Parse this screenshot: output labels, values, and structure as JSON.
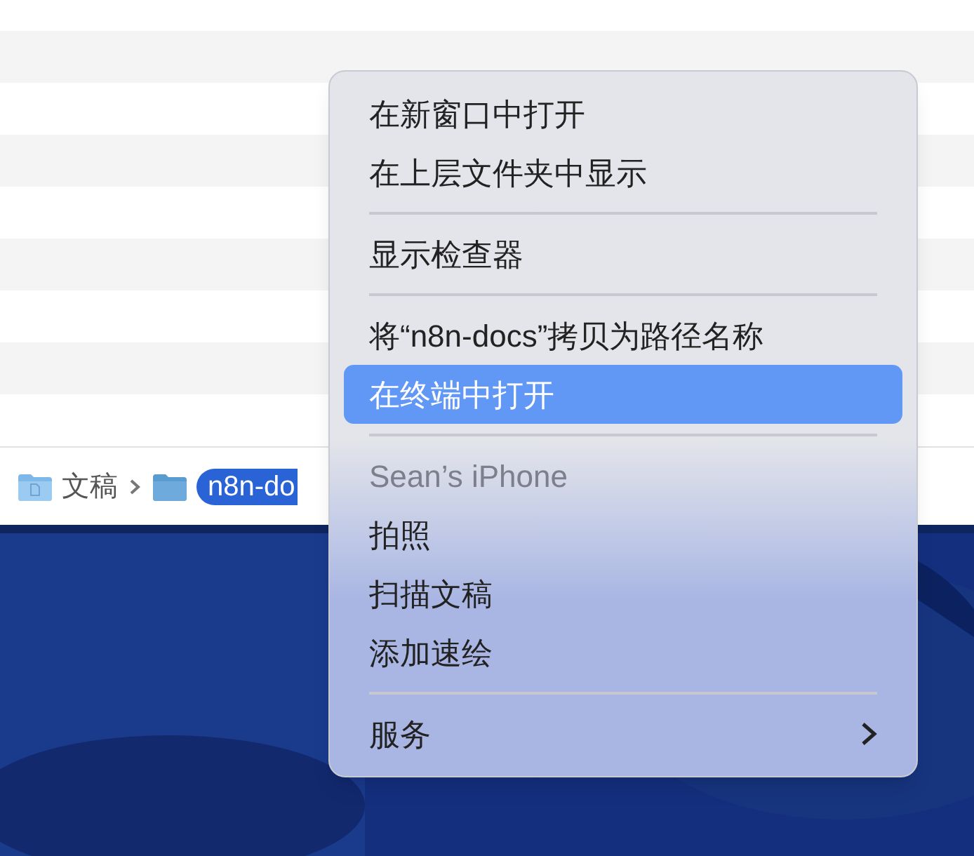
{
  "path_bar": [
    {
      "label": "文稿",
      "kind": "document-folder",
      "selected": false
    },
    {
      "label": "n8n-do",
      "kind": "folder",
      "selected": true
    }
  ],
  "context_menu": [
    {
      "kind": "item",
      "label": "在新窗口中打开",
      "selected": false
    },
    {
      "kind": "item",
      "label": "在上层文件夹中显示",
      "selected": false
    },
    {
      "kind": "separator"
    },
    {
      "kind": "item",
      "label": "显示检查器",
      "selected": false
    },
    {
      "kind": "separator"
    },
    {
      "kind": "item",
      "label": "将“n8n-docs”拷贝为路径名称",
      "selected": false
    },
    {
      "kind": "item",
      "label": "在终端中打开",
      "selected": true
    },
    {
      "kind": "separator"
    },
    {
      "kind": "header",
      "label": "Sean’s iPhone"
    },
    {
      "kind": "item",
      "label": "拍照",
      "selected": false
    },
    {
      "kind": "item",
      "label": "扫描文稿",
      "selected": false
    },
    {
      "kind": "item",
      "label": "添加速绘",
      "selected": false
    },
    {
      "kind": "separator"
    },
    {
      "kind": "submenu",
      "label": "服务",
      "selected": false
    }
  ]
}
